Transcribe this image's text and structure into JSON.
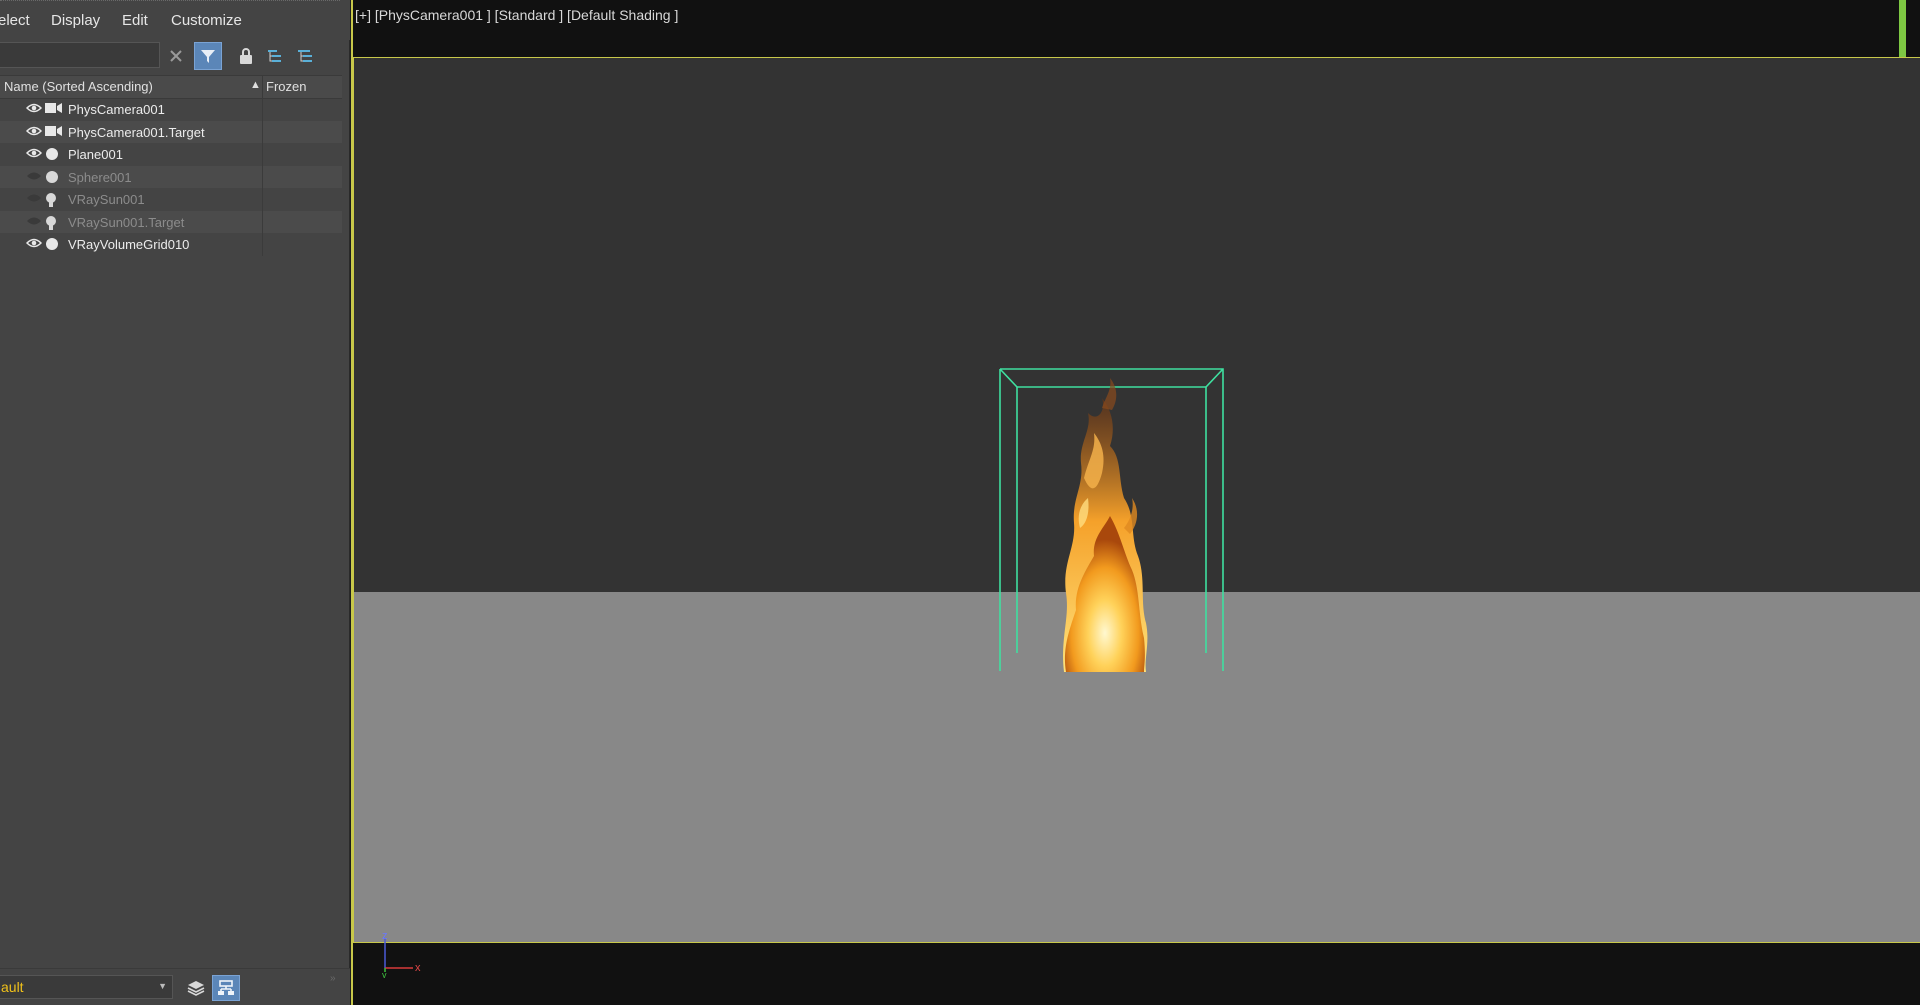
{
  "scene_explorer": {
    "menu": [
      "elect",
      "Display",
      "Edit",
      "Customize"
    ],
    "search": {
      "value": "",
      "placeholder": ""
    },
    "columns": {
      "name": "Name (Sorted Ascending)",
      "sort_indicator": "▲",
      "frozen": "Frozen"
    },
    "objects": [
      {
        "name": "PhysCamera001",
        "type": "camera",
        "visible": true
      },
      {
        "name": "PhysCamera001.Target",
        "type": "camera",
        "visible": true
      },
      {
        "name": "Plane001",
        "type": "geometry",
        "visible": true
      },
      {
        "name": "Sphere001",
        "type": "geometry",
        "visible": false
      },
      {
        "name": "VRaySun001",
        "type": "light",
        "visible": false
      },
      {
        "name": "VRaySun001.Target",
        "type": "light",
        "visible": false
      },
      {
        "name": "VRayVolumeGrid010",
        "type": "geometry",
        "visible": true
      }
    ],
    "layer": {
      "value": "ault"
    },
    "frozen_icon": "❄"
  },
  "viewport": {
    "label": "[+] [PhysCamera001 ] [Standard ] [Default Shading ]",
    "axis": {
      "z": "z",
      "x": "x",
      "y": "y"
    }
  },
  "colors": {
    "accent_button": "#5b86b8",
    "safe_frame": "#c8c84a",
    "gizmo": "#3fe0a0",
    "layer_text": "#f0c11a",
    "marker": "#7ec843"
  }
}
